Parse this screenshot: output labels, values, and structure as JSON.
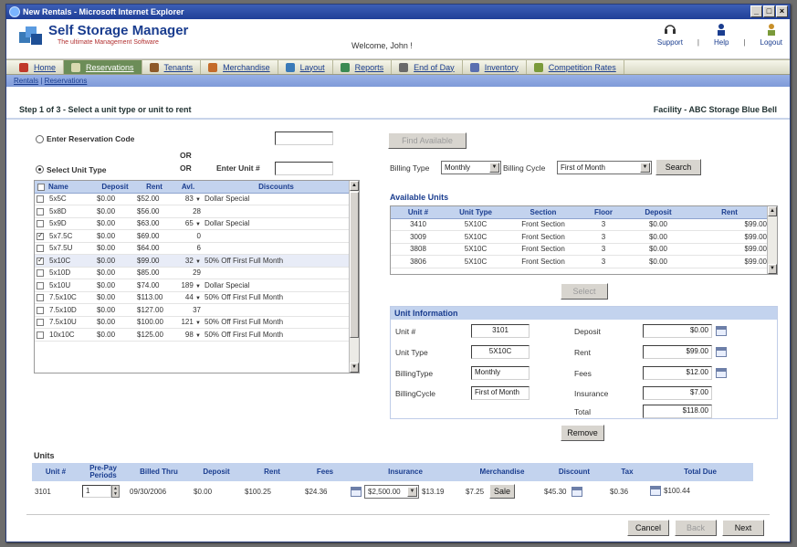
{
  "window": {
    "title": "New Rentals - Microsoft Internet Explorer"
  },
  "app": {
    "title": "Self Storage Manager",
    "subtitle": "The ultimate Management Software",
    "welcome": "Welcome, John !"
  },
  "toplinks": [
    {
      "label": "Support",
      "icon": "support-icon"
    },
    {
      "label": "Help",
      "icon": "help-icon"
    },
    {
      "label": "Logout",
      "icon": "logout-icon"
    }
  ],
  "toplink_sep": "|",
  "nav": [
    {
      "label": "Home",
      "color": "#c0392b"
    },
    {
      "label": "Reservations",
      "color": "#d9d9b0",
      "active": true
    },
    {
      "label": "Tenants",
      "color": "#8e5a2a"
    },
    {
      "label": "Merchandise",
      "color": "#c46b2a"
    },
    {
      "label": "Layout",
      "color": "#3a7ab8"
    },
    {
      "label": "Reports",
      "color": "#3b8a52"
    },
    {
      "label": "End of Day",
      "color": "#6a6a6a"
    },
    {
      "label": "Inventory",
      "color": "#5a6fb0"
    },
    {
      "label": "Competition Rates",
      "color": "#7a9a3a"
    }
  ],
  "subnav": {
    "a": "Rentals",
    "sep": "|",
    "b": "Reservations"
  },
  "step": "Step 1 of 3 - Select a unit type or unit to rent",
  "facility": "Facility - ABC Storage Blue Bell",
  "left": {
    "reservation_label": "Enter Reservation Code",
    "or1": "OR",
    "or2": "OR",
    "select_type_label": "Select Unit Type",
    "enter_unit_label": "Enter Unit #",
    "headers": [
      "Name",
      "Deposit",
      "Rent",
      "Avl.",
      "Discounts"
    ],
    "rows": [
      {
        "name": "5x5C",
        "deposit": "$0.00",
        "rent": "$52.00",
        "avl": "83",
        "disc": "Dollar Special",
        "dd": true
      },
      {
        "name": "5x8D",
        "deposit": "$0.00",
        "rent": "$56.00",
        "avl": "28",
        "disc": "",
        "dd": false
      },
      {
        "name": "5x9D",
        "deposit": "$0.00",
        "rent": "$63.00",
        "avl": "65",
        "disc": "Dollar Special",
        "dd": true
      },
      {
        "name": "5x7.5C",
        "deposit": "$0.00",
        "rent": "$69.00",
        "avl": "0",
        "disc": "",
        "dd": false,
        "checked": true
      },
      {
        "name": "5x7.5U",
        "deposit": "$0.00",
        "rent": "$64.00",
        "avl": "6",
        "disc": "",
        "dd": false
      },
      {
        "name": "5x10C",
        "deposit": "$0.00",
        "rent": "$99.00",
        "avl": "32",
        "disc": "50% Off First Full Month",
        "dd": true,
        "checked": true,
        "selected": true
      },
      {
        "name": "5x10D",
        "deposit": "$0.00",
        "rent": "$85.00",
        "avl": "29",
        "disc": "",
        "dd": false
      },
      {
        "name": "5x10U",
        "deposit": "$0.00",
        "rent": "$74.00",
        "avl": "189",
        "disc": "Dollar Special",
        "dd": true
      },
      {
        "name": "7.5x10C",
        "deposit": "$0.00",
        "rent": "$113.00",
        "avl": "44",
        "disc": "50% Off First Full Month",
        "dd": true
      },
      {
        "name": "7.5x10D",
        "deposit": "$0.00",
        "rent": "$127.00",
        "avl": "37",
        "disc": "",
        "dd": false
      },
      {
        "name": "7.5x10U",
        "deposit": "$0.00",
        "rent": "$100.00",
        "avl": "121",
        "disc": "50% Off First Full Month",
        "dd": true
      },
      {
        "name": "10x10C",
        "deposit": "$0.00",
        "rent": "$125.00",
        "avl": "98",
        "disc": "50% Off First Full Month",
        "dd": true
      }
    ]
  },
  "right": {
    "find_button": "Find Available",
    "billing_type_label": "Billing Type",
    "billing_type_value": "Monthly",
    "billing_cycle_label": "Billing Cycle",
    "billing_cycle_value": "First of Month",
    "search_button": "Search",
    "available_title": "Available Units",
    "avail_headers": [
      "Unit #",
      "Unit Type",
      "Section",
      "Floor",
      "Deposit",
      "Rent"
    ],
    "avail_rows": [
      [
        "3410",
        "5X10C",
        "Front Section",
        "3",
        "$0.00",
        "$99.00"
      ],
      [
        "3009",
        "5X10C",
        "Front Section",
        "3",
        "$0.00",
        "$99.00"
      ],
      [
        "3808",
        "5X10C",
        "Front Section",
        "3",
        "$0.00",
        "$99.00"
      ],
      [
        "3806",
        "5X10C",
        "Front Section",
        "3",
        "$0.00",
        "$99.00"
      ]
    ],
    "select_button": "Select",
    "unit_info_title": "Unit Information",
    "ui_left_labels": [
      "Unit #",
      "Unit Type",
      "BillingType",
      "BillingCycle"
    ],
    "ui_left_values": [
      "3101",
      "5X10C",
      "Monthly",
      "First of Month"
    ],
    "ui_right_labels": [
      "Deposit",
      "Rent",
      "Fees",
      "Insurance",
      "Total"
    ],
    "ui_right_values": [
      "$0.00",
      "$99.00",
      "$12.00",
      "$7.00",
      "$118.00"
    ],
    "remove_button": "Remove"
  },
  "units": {
    "label": "Units",
    "headers": [
      "Unit #",
      "Pre-Pay Periods",
      "Billed Thru",
      "Deposit",
      "Rent",
      "Fees",
      "Insurance",
      "Merchandise",
      "Discount",
      "Tax",
      "Total Due"
    ],
    "row": {
      "unit": "3101",
      "prepay": "1",
      "billed": "09/30/2006",
      "deposit": "$0.00",
      "rent": "$100.25",
      "fees": "$24.36",
      "insurance_select": "$2,500.00",
      "insurance": "$13.19",
      "merch": "$7.25",
      "sale_button": "Sale",
      "discount": "$45.30",
      "tax": "$0.36",
      "total": "$100.44"
    }
  },
  "footer": {
    "cancel": "Cancel",
    "back": "Back",
    "next": "Next"
  }
}
